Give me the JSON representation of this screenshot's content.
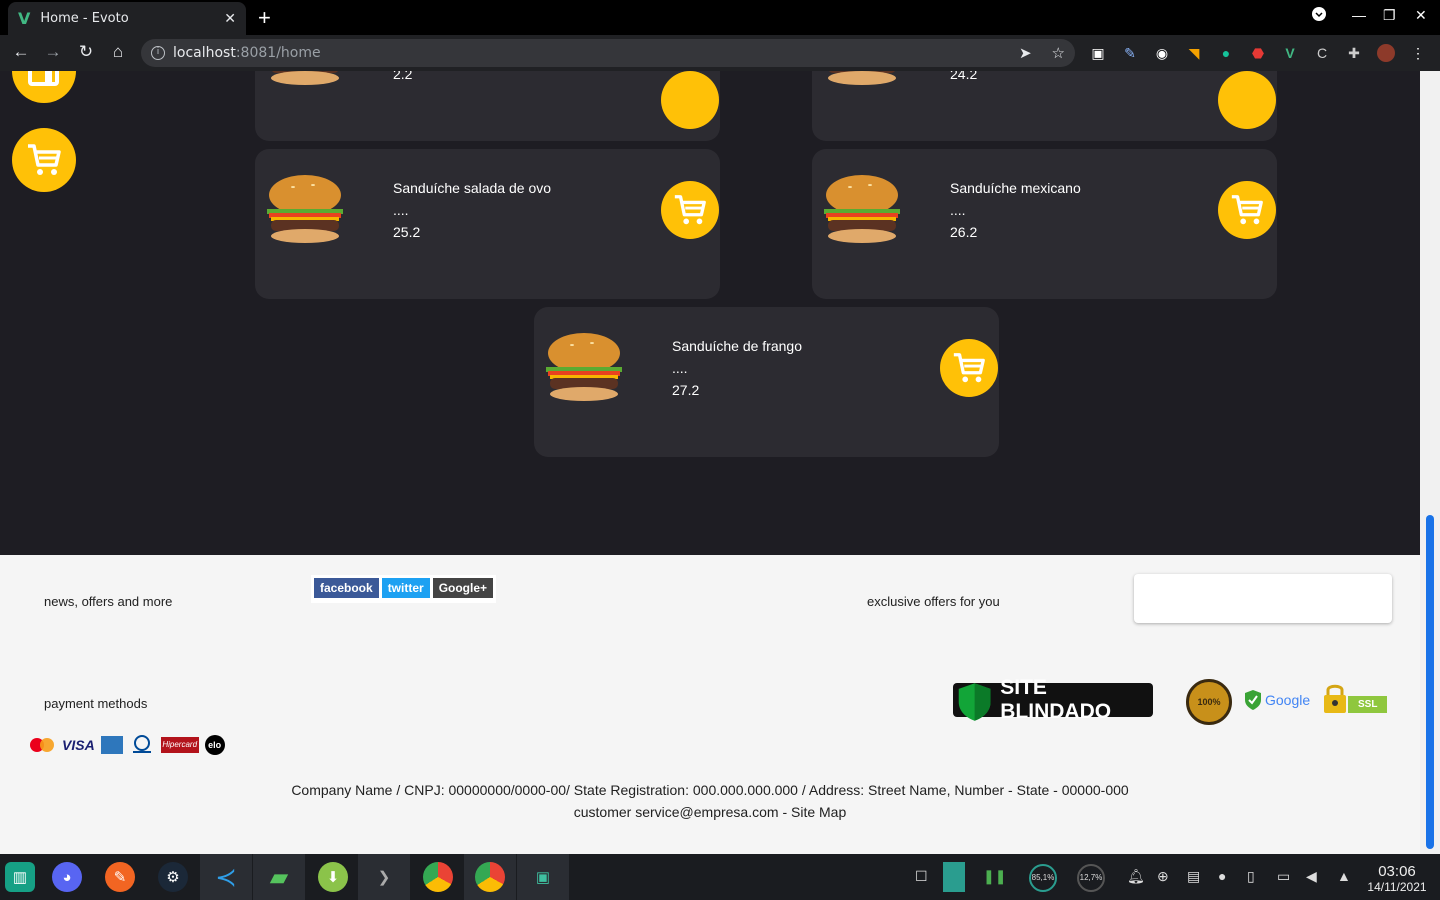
{
  "browser": {
    "tab_title": "Home - Evoto",
    "favicon": "vue-v-icon",
    "url_host": "localhost",
    "url_path": ":8081/home"
  },
  "sidebar": {
    "buttons": [
      {
        "icon": "orders-icon"
      },
      {
        "icon": "cart-icon"
      }
    ]
  },
  "products": [
    {
      "name": "",
      "desc": "",
      "price": "2.2",
      "partial": true
    },
    {
      "name": "",
      "desc": "",
      "price": "24.2",
      "partial": true
    },
    {
      "name": "Sanduíche salada de ovo",
      "desc": "....",
      "price": "25.2"
    },
    {
      "name": "Sanduíche mexicano",
      "desc": "....",
      "price": "26.2"
    },
    {
      "name": "Sanduíche de frango",
      "desc": "....",
      "price": "27.2"
    }
  ],
  "footer": {
    "newsletter_label": "news, offers and more",
    "social": [
      "facebook",
      "twitter",
      "Google+"
    ],
    "offers_label": "exclusive offers for you",
    "email_value": "",
    "payment_label": "payment methods",
    "payment_cards": [
      "MasterCard",
      "VISA",
      "AMEX",
      "Diners Club",
      "Hipercard",
      "elo"
    ],
    "seal_blindado": "SITE BLINDADO",
    "seal_100": "100%",
    "seal_google": "Google",
    "seal_ssl": "SSL",
    "legal_line1": "Company Name / CNPJ: 00000000/0000-00/ State Registration: 000.000.000.000 / Address: Street Name, Number - State - 00000-000",
    "legal_line2": "customer service@empresa.com - Site Map"
  },
  "taskbar": {
    "cpu": "85,1%",
    "mem": "12,7%",
    "time": "03:06",
    "date": "14/11/2021"
  },
  "colors": {
    "accent": "#ffc107",
    "page_bg": "#1e1d23",
    "card_bg": "#2c2b31",
    "footer_bg": "#f5f5f5"
  }
}
